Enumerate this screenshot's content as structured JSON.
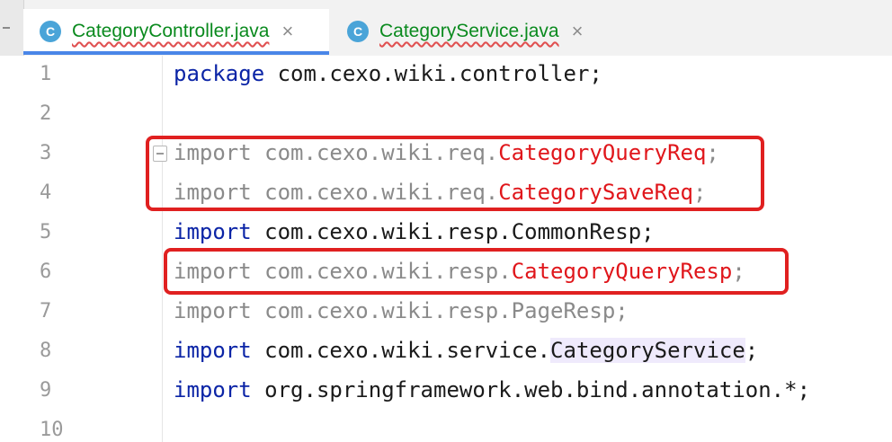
{
  "tabs": [
    {
      "badge": "C",
      "name": "CategoryController.java",
      "close": "×",
      "active": true
    },
    {
      "badge": "C",
      "name": "CategoryService.java",
      "close": "×",
      "active": false
    }
  ],
  "editor": {
    "lines": [
      {
        "num": "1"
      },
      {
        "num": "2"
      },
      {
        "num": "3"
      },
      {
        "num": "4"
      },
      {
        "num": "5"
      },
      {
        "num": "6"
      },
      {
        "num": "7"
      },
      {
        "num": "8"
      },
      {
        "num": "9"
      },
      {
        "num": "10"
      }
    ],
    "code": {
      "l1_kw": "package",
      "l1_rest": " com.cexo.wiki.controller;",
      "l3_pre": "import com.cexo.wiki.req.",
      "l3_cls": "CategoryQueryReq",
      "l3_end": ";",
      "l4_pre": "import com.cexo.wiki.req.",
      "l4_cls": "CategorySaveReq",
      "l4_end": ";",
      "l5_kw": "import",
      "l5_rest": " com.cexo.wiki.resp.CommonResp;",
      "l6_pre": "import com.cexo.wiki.resp.",
      "l6_cls": "CategoryQueryResp",
      "l6_end": ";",
      "l7": "import com.cexo.wiki.resp.PageResp;",
      "l8_kw": "import",
      "l8_pre": " com.cexo.wiki.service.",
      "l8_cls": "CategoryService",
      "l8_end": ";",
      "l9_kw": "import",
      "l9_rest": " org.springframework.web.bind.annotation.*;"
    }
  },
  "colors": {
    "keyword": "#0b24a6",
    "unused_import": "#8a8a8a",
    "error_class": "#e0161b",
    "tab_name": "#0a8a1e",
    "annotation_box": "#e02020",
    "highlight": "#efeafc"
  }
}
